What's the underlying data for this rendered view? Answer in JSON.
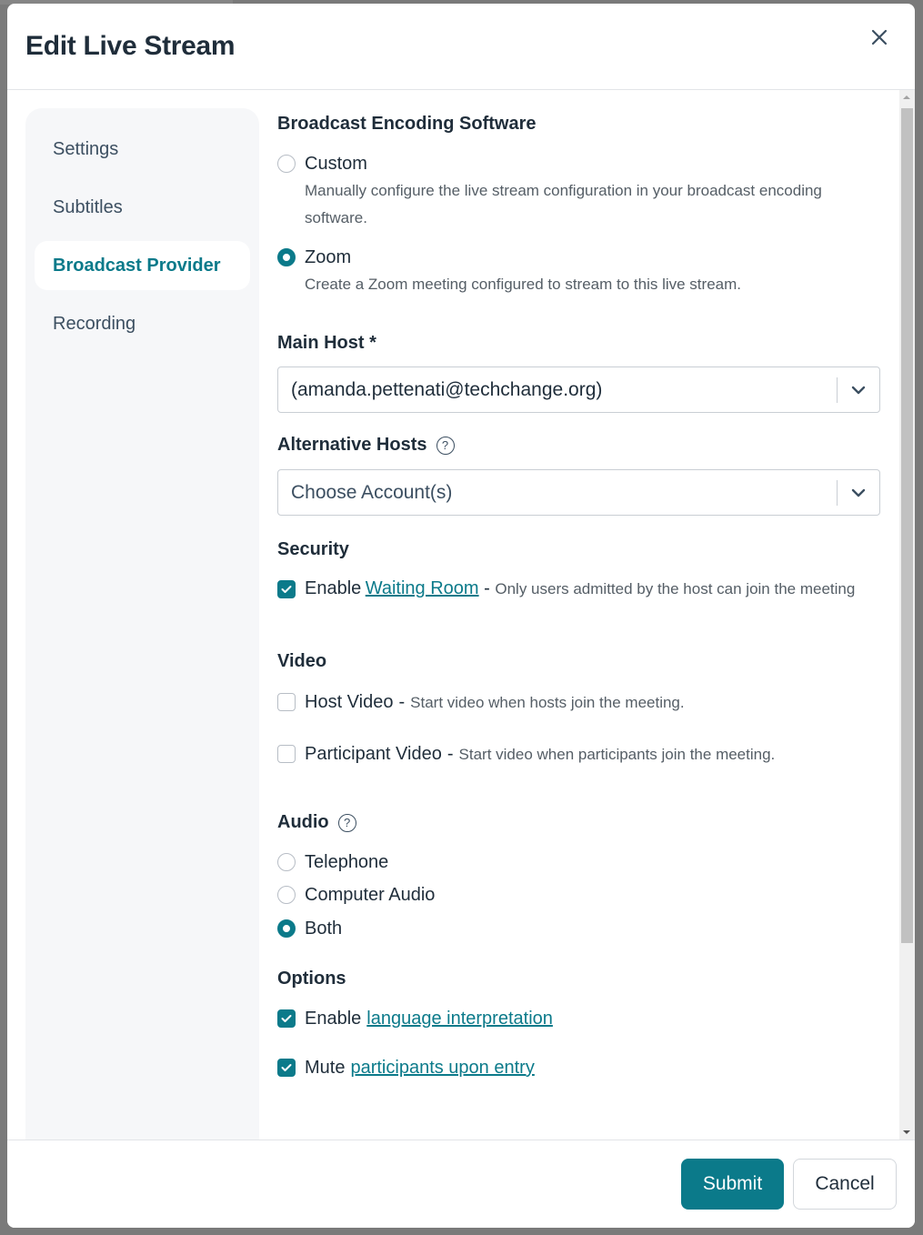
{
  "modal": {
    "title": "Edit Live Stream",
    "close_icon": "close-icon"
  },
  "sidebar": {
    "items": [
      {
        "label": "Settings",
        "active": false
      },
      {
        "label": "Subtitles",
        "active": false
      },
      {
        "label": "Broadcast Provider",
        "active": true
      },
      {
        "label": "Recording",
        "active": false
      }
    ]
  },
  "encoding": {
    "title": "Broadcast Encoding Software",
    "options": [
      {
        "label": "Custom",
        "description": "Manually configure the live stream configuration in your broadcast encoding software.",
        "selected": false
      },
      {
        "label": "Zoom",
        "description": "Create a Zoom meeting configured to stream to this live stream.",
        "selected": true
      }
    ]
  },
  "main_host": {
    "label": "Main Host *",
    "value": "(amanda.pettenati@techchange.org)"
  },
  "alternative_hosts": {
    "label": "Alternative Hosts",
    "help_icon": "help-circle-icon",
    "placeholder": "Choose Account(s)"
  },
  "security": {
    "title": "Security",
    "waiting_room": {
      "prefix": "Enable",
      "link": "Waiting Room",
      "dash": " - ",
      "description": "Only users admitted by the host can join the meeting",
      "checked": true
    }
  },
  "video": {
    "title": "Video",
    "options": [
      {
        "label": "Host Video",
        "description": "Start video when hosts join the meeting.",
        "checked": false
      },
      {
        "label": "Participant Video",
        "description": "Start video when participants join the meeting.",
        "checked": false
      }
    ]
  },
  "audio": {
    "title": "Audio",
    "help_icon": "help-circle-icon",
    "options": [
      {
        "label": "Telephone",
        "selected": false
      },
      {
        "label": "Computer Audio",
        "selected": false
      },
      {
        "label": "Both",
        "selected": true
      }
    ]
  },
  "options": {
    "title": "Options",
    "items": [
      {
        "prefix": "Enable",
        "link": "language interpretation",
        "checked": true
      },
      {
        "prefix": "Mute",
        "link": "participants upon entry",
        "checked": true
      }
    ]
  },
  "footer": {
    "submit_label": "Submit",
    "cancel_label": "Cancel"
  },
  "colors": {
    "accent": "#0b7a8a",
    "text": "#1f2d3a",
    "muted": "#555e66"
  }
}
